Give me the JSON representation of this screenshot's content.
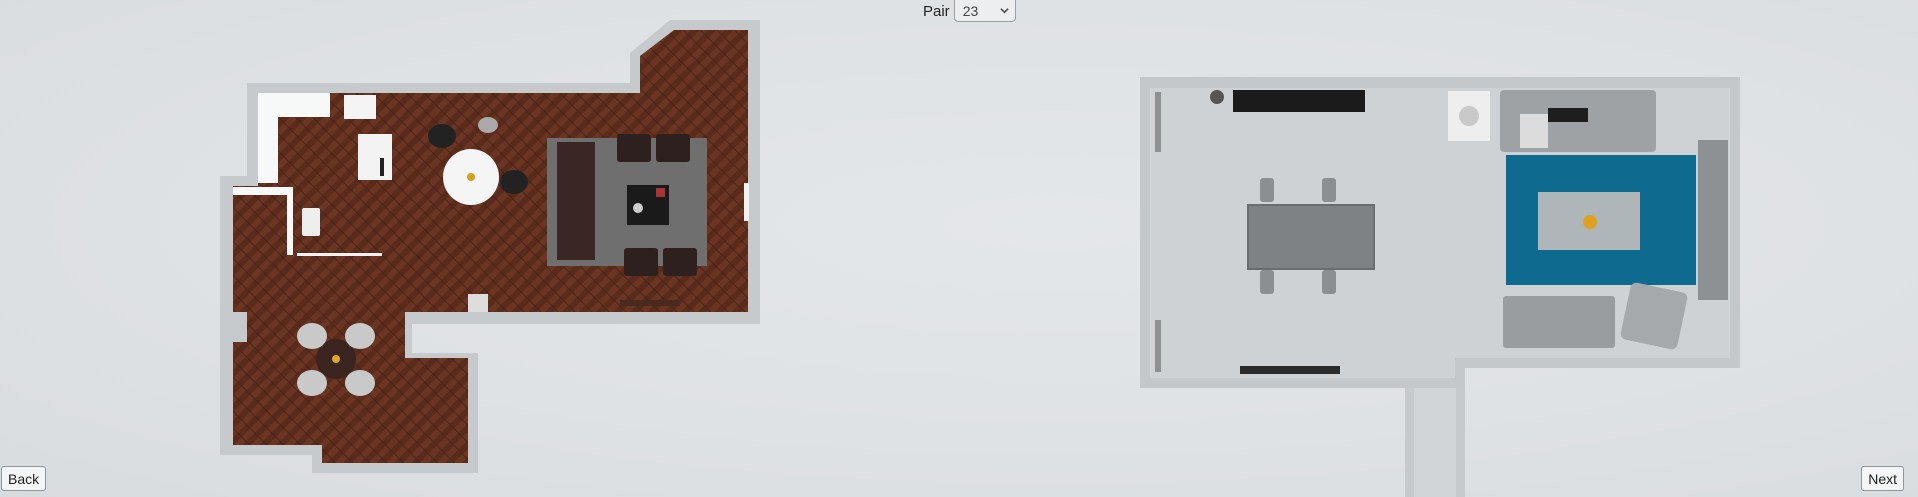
{
  "pair": {
    "label": "Pair",
    "value": "23"
  },
  "nav": {
    "back_label": "Back",
    "next_label": "Next"
  },
  "colors": {
    "background": "#dfe2e5",
    "wood_floor": "#5a2a1a",
    "wall": "#c9ccd0",
    "rug_teal": "#0f6a8f",
    "tile_floor": "#cfd2d4"
  },
  "icons": {
    "dropdown": "chevron-down-icon"
  }
}
